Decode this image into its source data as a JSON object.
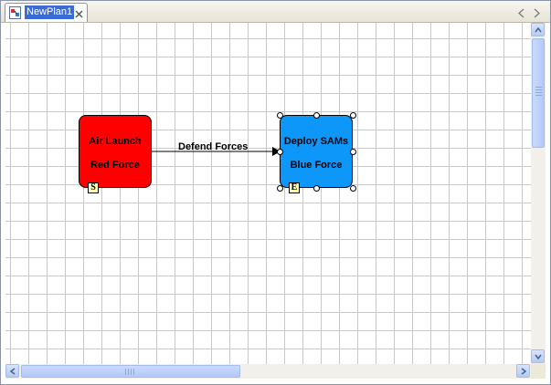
{
  "tab": {
    "title": "NewPlan1",
    "icon": "plan-document-icon",
    "close_icon": "close-icon"
  },
  "nav": {
    "left_icon": "tab-scroll-left-icon",
    "right_icon": "tab-scroll-right-icon"
  },
  "diagram": {
    "nodes": [
      {
        "id": "air-launch",
        "title": "Air Launch",
        "force": "Red Force",
        "color": "#ff0000",
        "marker": "S"
      },
      {
        "id": "deploy-sams",
        "title": "Deploy SAMs",
        "force": "Blue Force",
        "color": "#0d97f9",
        "marker": "E"
      }
    ],
    "edges": [
      {
        "from": "air-launch",
        "to": "deploy-sams",
        "label": "Defend Forces"
      }
    ]
  },
  "colors": {
    "grid": "#c8c8c8",
    "selected_tab": "#3d6bd6",
    "marker_fill": "#ffffb0"
  }
}
